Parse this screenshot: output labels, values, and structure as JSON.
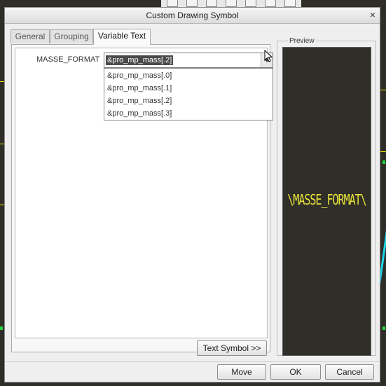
{
  "dialog": {
    "title": "Custom Drawing Symbol",
    "close_label": "×"
  },
  "tabs": [
    {
      "label": "General",
      "active": false
    },
    {
      "label": "Grouping",
      "active": false
    },
    {
      "label": "Variable Text",
      "active": true
    }
  ],
  "variable": {
    "name": "MASSE_FORMAT",
    "selected_value": "&pro_mp_mass[.2]",
    "options": [
      "&pro_mp_mass[.0]",
      "&pro_mp_mass[.1]",
      "&pro_mp_mass[.2]",
      "&pro_mp_mass[.3]"
    ]
  },
  "text_symbol_button": "Text Symbol >>",
  "preview": {
    "label": "Preview",
    "text": "\\MASSE_FORMAT\\"
  },
  "footer": {
    "move": "Move",
    "ok": "OK",
    "cancel": "Cancel"
  },
  "colors": {
    "preview_bg": "#2f2e28",
    "preview_text": "#e8e23a",
    "selection_bg": "#4a4a4a"
  },
  "icons": [
    "combo-arrow-icon",
    "mouse-cursor-icon"
  ]
}
